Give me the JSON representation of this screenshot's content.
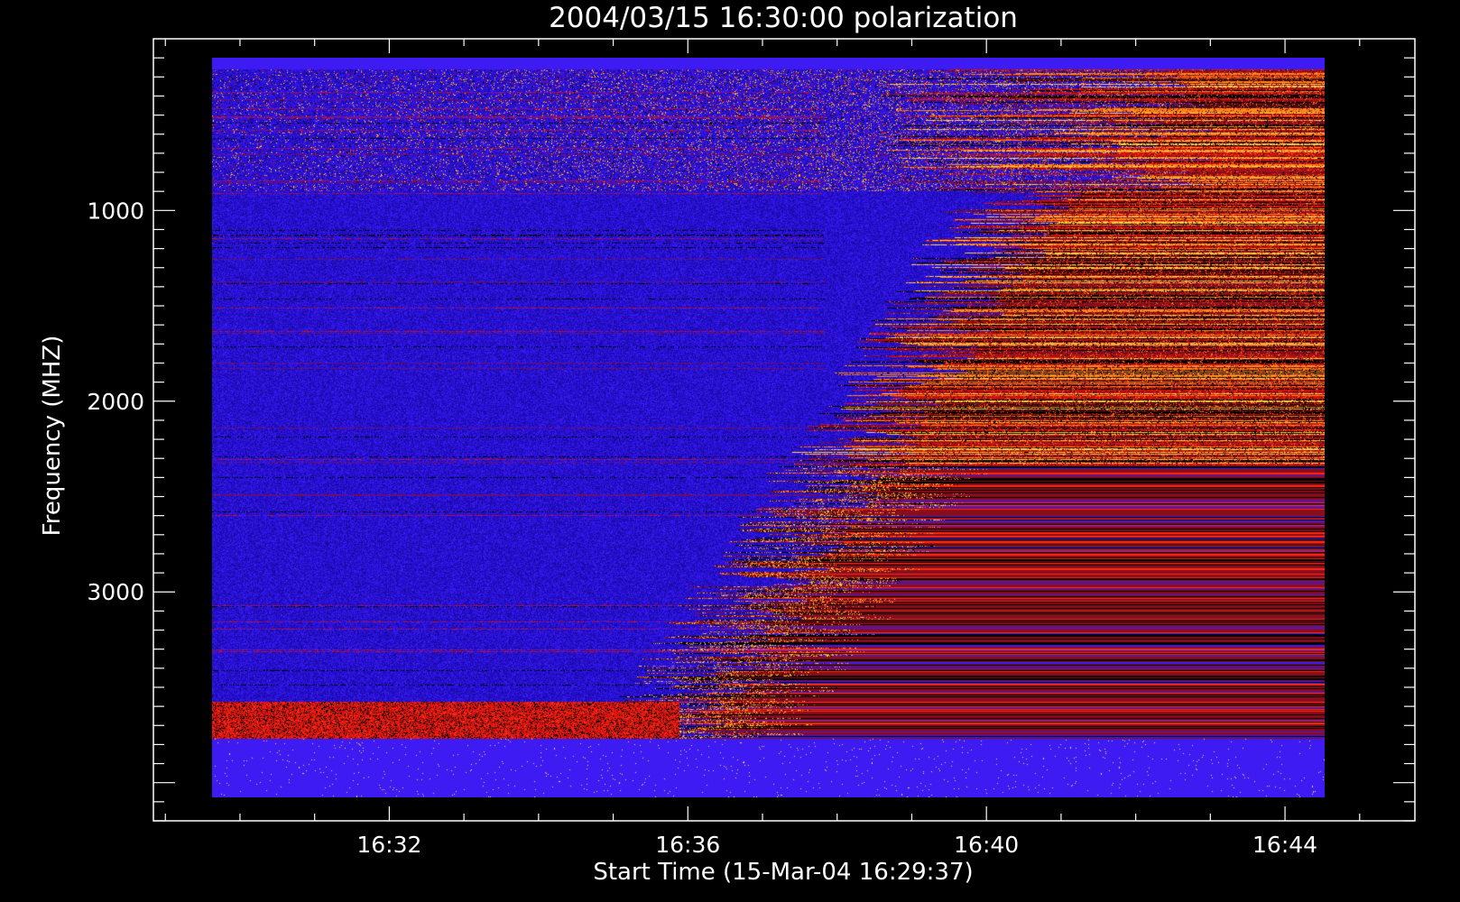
{
  "chart_data": {
    "type": "heatmap",
    "title": "2004/03/15 16:30:00 polarization",
    "xlabel": "Start Time (15-Mar-04 16:29:37)",
    "ylabel": "Frequency (MHZ)",
    "x_ticks": [
      {
        "label": "16:32",
        "minutes": 2.38
      },
      {
        "label": "16:36",
        "minutes": 6.38
      },
      {
        "label": "16:40",
        "minutes": 10.38
      },
      {
        "label": "16:44",
        "minutes": 14.38
      }
    ],
    "y_ticks": [
      {
        "label": "1000",
        "value": 1000
      },
      {
        "label": "2000",
        "value": 2000
      },
      {
        "label": "3000",
        "value": 3000
      }
    ],
    "xlim_minutes": [
      -0.78,
      16.12
    ],
    "ylim_mhz": [
      100,
      4200
    ],
    "data_x_minutes": [
      0,
      14.9
    ],
    "data_y_mhz": [
      200,
      4080
    ],
    "palette": [
      "#000000",
      "#1a0aa8",
      "#2a12e0",
      "#3d1bf2",
      "#8a0d1c",
      "#d01010",
      "#ff2a10",
      "#ff8a1a",
      "#ffd24a",
      "#ffffff"
    ],
    "background": "#000000",
    "grid": false
  }
}
